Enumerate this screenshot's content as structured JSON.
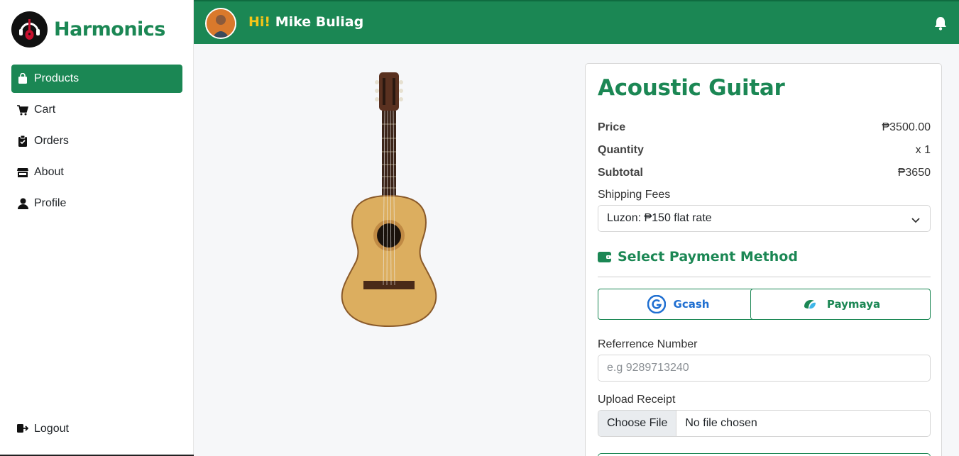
{
  "brand": {
    "name": "Harmonics",
    "logo_icon": "guitar-logo-icon"
  },
  "sidebar": {
    "items": [
      {
        "label": "Products",
        "icon": "bag-icon",
        "active": true
      },
      {
        "label": "Cart",
        "icon": "cart-icon",
        "active": false
      },
      {
        "label": "Orders",
        "icon": "clipboard-icon",
        "active": false
      },
      {
        "label": "About",
        "icon": "store-icon",
        "active": false
      },
      {
        "label": "Profile",
        "icon": "user-icon",
        "active": false
      }
    ],
    "logout_label": "Logout"
  },
  "header": {
    "hi": "Hi!",
    "user_name": "Mike Buliag",
    "bell_icon": "bell-icon"
  },
  "product": {
    "title": "Acoustic Guitar",
    "price_label": "Price",
    "price_value": "₱3500.00",
    "quantity_label": "Quantity",
    "quantity_value": "x 1",
    "subtotal_label": "Subtotal",
    "subtotal_value": "₱3650",
    "shipping_label": "Shipping Fees",
    "shipping_selected": "Luzon: ₱150 flat rate"
  },
  "payment": {
    "heading": "Select Payment Method",
    "gcash_label": "Gcash",
    "paymaya_label": "Paymaya",
    "reference_label": "Referrence Number",
    "reference_placeholder": "e.g 9289713240",
    "upload_label": "Upload Receipt",
    "choose_file_label": "Choose File",
    "no_file_label": "No file chosen"
  },
  "colors": {
    "brand_green": "#1b8754",
    "hi_yellow": "#f5c518",
    "gcash_blue": "#1f6fd1"
  }
}
